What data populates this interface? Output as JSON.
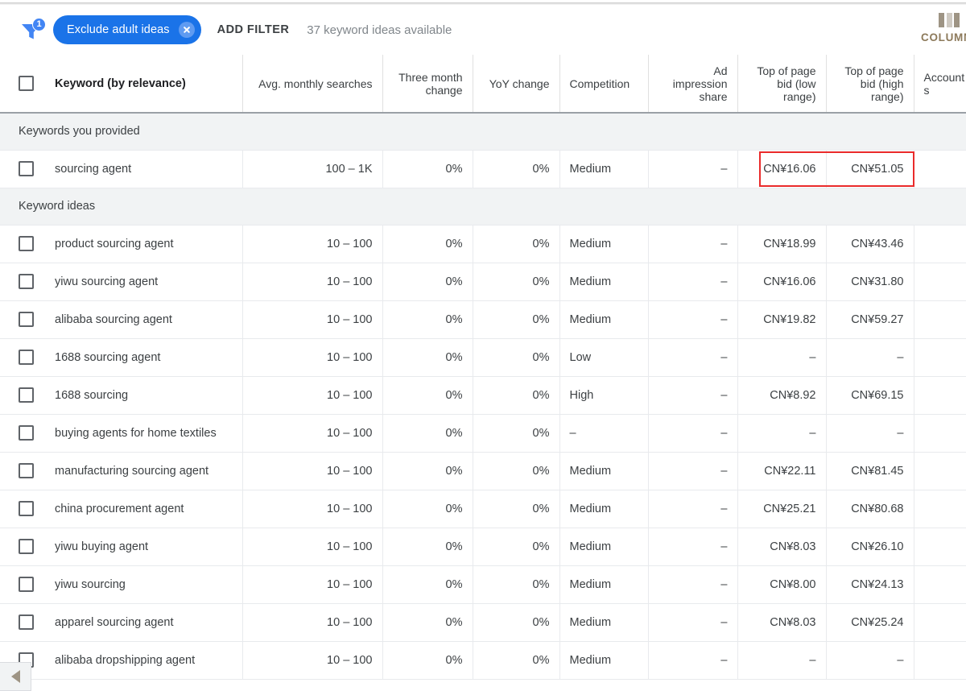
{
  "toolbar": {
    "filter_icon": "funnel-filter-icon",
    "filter_badge_count": "1",
    "chip_label": "Exclude adult ideas",
    "chip_close_icon": "close-circle-icon",
    "add_filter_label": "ADD FILTER",
    "ideas_available": "37 keyword ideas available",
    "columns_label": "COLUMNS",
    "columns_icon": "columns-icon",
    "accent_color": "#1a73e8"
  },
  "table": {
    "columns": [
      {
        "label": "Keyword (by relevance)",
        "align": "left"
      },
      {
        "label": "Avg. monthly searches",
        "align": "right"
      },
      {
        "label": "Three month change",
        "align": "right"
      },
      {
        "label": "YoY change",
        "align": "right"
      },
      {
        "label": "Competition",
        "align": "left"
      },
      {
        "label": "Ad impression share",
        "align": "right"
      },
      {
        "label": "Top of page bid (low range)",
        "align": "right"
      },
      {
        "label": "Top of page bid (high range)",
        "align": "right"
      },
      {
        "label": "Account s",
        "align": "left"
      }
    ],
    "groups": [
      {
        "title": "Keywords you provided",
        "rows": [
          {
            "keyword": "sourcing agent",
            "avg_monthly_searches": "100 – 1K",
            "three_month_change": "0%",
            "yoy_change": "0%",
            "competition": "Medium",
            "ad_impression_share": "–",
            "bid_low": "CN¥16.06",
            "bid_high": "CN¥51.05",
            "highlighted": true
          }
        ]
      },
      {
        "title": "Keyword ideas",
        "rows": [
          {
            "keyword": "product sourcing agent",
            "avg_monthly_searches": "10 – 100",
            "three_month_change": "0%",
            "yoy_change": "0%",
            "competition": "Medium",
            "ad_impression_share": "–",
            "bid_low": "CN¥18.99",
            "bid_high": "CN¥43.46"
          },
          {
            "keyword": "yiwu sourcing agent",
            "avg_monthly_searches": "10 – 100",
            "three_month_change": "0%",
            "yoy_change": "0%",
            "competition": "Medium",
            "ad_impression_share": "–",
            "bid_low": "CN¥16.06",
            "bid_high": "CN¥31.80"
          },
          {
            "keyword": "alibaba sourcing agent",
            "avg_monthly_searches": "10 – 100",
            "three_month_change": "0%",
            "yoy_change": "0%",
            "competition": "Medium",
            "ad_impression_share": "–",
            "bid_low": "CN¥19.82",
            "bid_high": "CN¥59.27"
          },
          {
            "keyword": "1688 sourcing agent",
            "avg_monthly_searches": "10 – 100",
            "three_month_change": "0%",
            "yoy_change": "0%",
            "competition": "Low",
            "ad_impression_share": "–",
            "bid_low": "–",
            "bid_high": "–"
          },
          {
            "keyword": "1688 sourcing",
            "avg_monthly_searches": "10 – 100",
            "three_month_change": "0%",
            "yoy_change": "0%",
            "competition": "High",
            "ad_impression_share": "–",
            "bid_low": "CN¥8.92",
            "bid_high": "CN¥69.15"
          },
          {
            "keyword": "buying agents for home textiles",
            "avg_monthly_searches": "10 – 100",
            "three_month_change": "0%",
            "yoy_change": "0%",
            "competition": "–",
            "ad_impression_share": "–",
            "bid_low": "–",
            "bid_high": "–"
          },
          {
            "keyword": "manufacturing sourcing agent",
            "avg_monthly_searches": "10 – 100",
            "three_month_change": "0%",
            "yoy_change": "0%",
            "competition": "Medium",
            "ad_impression_share": "–",
            "bid_low": "CN¥22.11",
            "bid_high": "CN¥81.45"
          },
          {
            "keyword": "china procurement agent",
            "avg_monthly_searches": "10 – 100",
            "three_month_change": "0%",
            "yoy_change": "0%",
            "competition": "Medium",
            "ad_impression_share": "–",
            "bid_low": "CN¥25.21",
            "bid_high": "CN¥80.68"
          },
          {
            "keyword": "yiwu buying agent",
            "avg_monthly_searches": "10 – 100",
            "three_month_change": "0%",
            "yoy_change": "0%",
            "competition": "Medium",
            "ad_impression_share": "–",
            "bid_low": "CN¥8.03",
            "bid_high": "CN¥26.10"
          },
          {
            "keyword": "yiwu sourcing",
            "avg_monthly_searches": "10 – 100",
            "three_month_change": "0%",
            "yoy_change": "0%",
            "competition": "Medium",
            "ad_impression_share": "–",
            "bid_low": "CN¥8.00",
            "bid_high": "CN¥24.13"
          },
          {
            "keyword": "apparel sourcing agent",
            "avg_monthly_searches": "10 – 100",
            "three_month_change": "0%",
            "yoy_change": "0%",
            "competition": "Medium",
            "ad_impression_share": "–",
            "bid_low": "CN¥8.03",
            "bid_high": "CN¥25.24"
          },
          {
            "keyword": "alibaba dropshipping agent",
            "avg_monthly_searches": "10 – 100",
            "three_month_change": "0%",
            "yoy_change": "0%",
            "competition": "Medium",
            "ad_impression_share": "–",
            "bid_low": "–",
            "bid_high": "–"
          }
        ]
      }
    ]
  },
  "annotation": {
    "highlight_color": "#ea2b2b"
  },
  "footer": {
    "scroll_left_icon": "scroll-left-arrow-icon"
  }
}
